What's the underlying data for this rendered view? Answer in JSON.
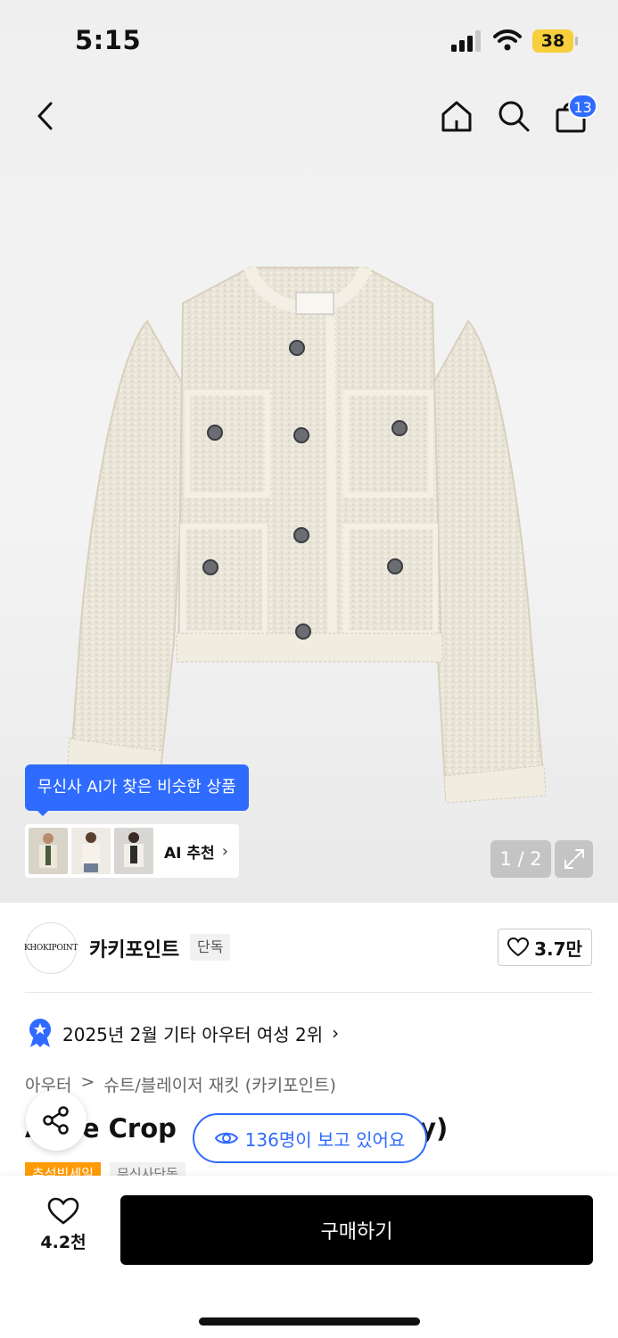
{
  "status_bar": {
    "time": "5:15",
    "battery": "38",
    "signal_icon": "cellular-signal-icon",
    "wifi_icon": "wifi-icon"
  },
  "nav": {
    "back_icon": "chevron-left-icon",
    "home_icon": "home-icon",
    "search_icon": "search-icon",
    "cart_icon": "shopping-bag-icon",
    "cart_count": "13"
  },
  "gallery": {
    "page_indicator": "1 / 2",
    "ai_tooltip": "무신사 AI가 찾은 비슷한 상품",
    "ai_reco_label": "AI 추천",
    "ai_reco_chevron": "›"
  },
  "brand": {
    "logo_text": "KHOKIPOINT",
    "name": "카키포인트",
    "exclusive_tag": "단독",
    "likes": "3.7만"
  },
  "ranking": {
    "text": "2025년 2월 기타 아우터 여성 2위",
    "chevron": "›"
  },
  "breadcrumb": [
    "아우터",
    ">",
    "슈트/블레이저 재킷 (카키포인트)"
  ],
  "product": {
    "title_left": "A",
    "title_visible": "que Crop",
    "title_right": "ory)",
    "tag_sale": "추석빅세일",
    "tag_exclusive": "무신사단독"
  },
  "viewers": {
    "text": "136명이 보고 있어요",
    "icon": "eye-icon"
  },
  "bottom_bar": {
    "wish_count": "4.2천",
    "buy_label": "구매하기"
  },
  "colors": {
    "accent_blue": "#2f6bff",
    "battery_yellow": "#f7cf3c",
    "sale_orange": "#ff9a00",
    "buy_black": "#000000"
  }
}
